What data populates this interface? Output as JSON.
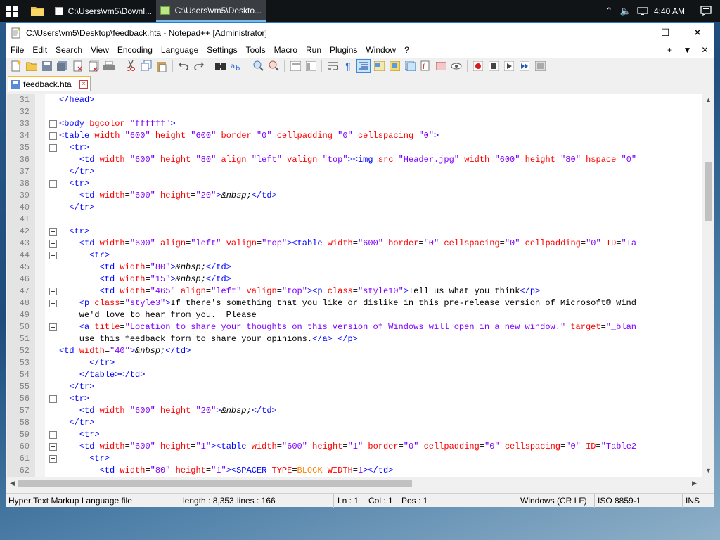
{
  "taskbar": {
    "tasks": [
      {
        "label": "C:\\Users\\vm5\\Downl..."
      },
      {
        "label": "C:\\Users\\vm5\\Deskto..."
      }
    ],
    "clock": "4:40 AM"
  },
  "window": {
    "title": "C:\\Users\\vm5\\Desktop\\feedback.hta - Notepad++ [Administrator]",
    "menus": [
      "File",
      "Edit",
      "Search",
      "View",
      "Encoding",
      "Language",
      "Settings",
      "Tools",
      "Macro",
      "Run",
      "Plugins",
      "Window",
      "?"
    ],
    "menu_right": [
      "+",
      "▼",
      "✕"
    ],
    "tab": {
      "label": "feedback.hta"
    }
  },
  "editor": {
    "lines": [
      {
        "n": "31",
        "fold": "line",
        "segs": [
          [
            "t",
            "</head>"
          ]
        ]
      },
      {
        "n": "32",
        "fold": "line",
        "segs": []
      },
      {
        "n": "33",
        "fold": "box",
        "segs": [
          [
            "t",
            "<body "
          ],
          [
            "a",
            "bgcolor"
          ],
          [
            "x",
            "="
          ],
          [
            "v",
            "\"ffffff\""
          ],
          [
            "t",
            ">"
          ]
        ]
      },
      {
        "n": "34",
        "fold": "box",
        "segs": [
          [
            "t",
            "<table "
          ],
          [
            "a",
            "width"
          ],
          [
            "x",
            "="
          ],
          [
            "v",
            "\"600\""
          ],
          [
            "a",
            " height"
          ],
          [
            "x",
            "="
          ],
          [
            "v",
            "\"600\""
          ],
          [
            "a",
            " border"
          ],
          [
            "x",
            "="
          ],
          [
            "v",
            "\"0\""
          ],
          [
            "a",
            " cellpadding"
          ],
          [
            "x",
            "="
          ],
          [
            "v",
            "\"0\""
          ],
          [
            "a",
            " cellspacing"
          ],
          [
            "x",
            "="
          ],
          [
            "v",
            "\"0\""
          ],
          [
            "t",
            ">"
          ]
        ]
      },
      {
        "n": "35",
        "fold": "box",
        "segs": [
          [
            "x",
            "  "
          ],
          [
            "t",
            "<tr>"
          ]
        ]
      },
      {
        "n": "36",
        "fold": "line",
        "segs": [
          [
            "x",
            "    "
          ],
          [
            "t",
            "<td "
          ],
          [
            "a",
            "width"
          ],
          [
            "x",
            "="
          ],
          [
            "v",
            "\"600\""
          ],
          [
            "a",
            " height"
          ],
          [
            "x",
            "="
          ],
          [
            "v",
            "\"80\""
          ],
          [
            "a",
            " align"
          ],
          [
            "x",
            "="
          ],
          [
            "v",
            "\"left\""
          ],
          [
            "a",
            " valign"
          ],
          [
            "x",
            "="
          ],
          [
            "v",
            "\"top\""
          ],
          [
            "t",
            "><img "
          ],
          [
            "a",
            "src"
          ],
          [
            "x",
            "="
          ],
          [
            "v",
            "\"Header.jpg\""
          ],
          [
            "a",
            " width"
          ],
          [
            "x",
            "="
          ],
          [
            "v",
            "\"600\""
          ],
          [
            "a",
            " height"
          ],
          [
            "x",
            "="
          ],
          [
            "v",
            "\"80\""
          ],
          [
            "a",
            " hspace"
          ],
          [
            "x",
            "="
          ],
          [
            "v",
            "\"0\""
          ]
        ]
      },
      {
        "n": "37",
        "fold": "line",
        "segs": [
          [
            "x",
            "  "
          ],
          [
            "t",
            "</tr>"
          ]
        ]
      },
      {
        "n": "38",
        "fold": "box",
        "segs": [
          [
            "x",
            "  "
          ],
          [
            "t",
            "<tr>"
          ]
        ]
      },
      {
        "n": "39",
        "fold": "line",
        "segs": [
          [
            "x",
            "    "
          ],
          [
            "t",
            "<td "
          ],
          [
            "a",
            "width"
          ],
          [
            "x",
            "="
          ],
          [
            "v",
            "\"600\""
          ],
          [
            "a",
            " height"
          ],
          [
            "x",
            "="
          ],
          [
            "v",
            "\"20\""
          ],
          [
            "t",
            ">"
          ],
          [
            "e",
            "&nbsp;"
          ],
          [
            "t",
            "</td>"
          ]
        ]
      },
      {
        "n": "40",
        "fold": "line",
        "segs": [
          [
            "x",
            "  "
          ],
          [
            "t",
            "</tr>"
          ]
        ]
      },
      {
        "n": "41",
        "fold": "line",
        "segs": []
      },
      {
        "n": "42",
        "fold": "box",
        "segs": [
          [
            "x",
            "  "
          ],
          [
            "t",
            "<tr>"
          ]
        ]
      },
      {
        "n": "43",
        "fold": "box",
        "segs": [
          [
            "x",
            "    "
          ],
          [
            "t",
            "<td "
          ],
          [
            "a",
            "width"
          ],
          [
            "x",
            "="
          ],
          [
            "v",
            "\"600\""
          ],
          [
            "a",
            " align"
          ],
          [
            "x",
            "="
          ],
          [
            "v",
            "\"left\""
          ],
          [
            "a",
            " valign"
          ],
          [
            "x",
            "="
          ],
          [
            "v",
            "\"top\""
          ],
          [
            "t",
            "><table "
          ],
          [
            "a",
            "width"
          ],
          [
            "x",
            "="
          ],
          [
            "v",
            "\"600\""
          ],
          [
            "a",
            " border"
          ],
          [
            "x",
            "="
          ],
          [
            "v",
            "\"0\""
          ],
          [
            "a",
            " cellspacing"
          ],
          [
            "x",
            "="
          ],
          [
            "v",
            "\"0\""
          ],
          [
            "a",
            " cellpadding"
          ],
          [
            "x",
            "="
          ],
          [
            "v",
            "\"0\""
          ],
          [
            "a",
            " ID"
          ],
          [
            "x",
            "="
          ],
          [
            "v",
            "\"Ta"
          ]
        ]
      },
      {
        "n": "44",
        "fold": "box",
        "segs": [
          [
            "x",
            "      "
          ],
          [
            "t",
            "<tr>"
          ]
        ]
      },
      {
        "n": "45",
        "fold": "line",
        "segs": [
          [
            "x",
            "        "
          ],
          [
            "t",
            "<td "
          ],
          [
            "a",
            "width"
          ],
          [
            "x",
            "="
          ],
          [
            "v",
            "\"80\""
          ],
          [
            "t",
            ">"
          ],
          [
            "e",
            "&nbsp;"
          ],
          [
            "t",
            "</td>"
          ]
        ]
      },
      {
        "n": "46",
        "fold": "line",
        "segs": [
          [
            "x",
            "        "
          ],
          [
            "t",
            "<td "
          ],
          [
            "a",
            "width"
          ],
          [
            "x",
            "="
          ],
          [
            "v",
            "\"15\""
          ],
          [
            "t",
            ">"
          ],
          [
            "e",
            "&nbsp;"
          ],
          [
            "t",
            "</td>"
          ]
        ]
      },
      {
        "n": "47",
        "fold": "box",
        "segs": [
          [
            "x",
            "        "
          ],
          [
            "t",
            "<td "
          ],
          [
            "a",
            "width"
          ],
          [
            "x",
            "="
          ],
          [
            "v",
            "\"465\""
          ],
          [
            "a",
            " align"
          ],
          [
            "x",
            "="
          ],
          [
            "v",
            "\"left\""
          ],
          [
            "a",
            " valign"
          ],
          [
            "x",
            "="
          ],
          [
            "v",
            "\"top\""
          ],
          [
            "t",
            "><p "
          ],
          [
            "a",
            "class"
          ],
          [
            "x",
            "="
          ],
          [
            "v",
            "\"style10\""
          ],
          [
            "t",
            ">"
          ],
          [
            "x",
            "Tell us what you think"
          ],
          [
            "t",
            "</p>"
          ]
        ]
      },
      {
        "n": "48",
        "fold": "box",
        "segs": [
          [
            "x",
            "    "
          ],
          [
            "t",
            "<p "
          ],
          [
            "a",
            "class"
          ],
          [
            "x",
            "="
          ],
          [
            "v",
            "\"style3\""
          ],
          [
            "t",
            ">"
          ],
          [
            "x",
            "If there's something that you like or dislike in this pre-release version of Microsoft® Wind"
          ]
        ]
      },
      {
        "n": "49",
        "fold": "line",
        "segs": [
          [
            "x",
            "    we'd love to hear from you.  Please"
          ]
        ]
      },
      {
        "n": "50",
        "fold": "box",
        "segs": [
          [
            "x",
            "    "
          ],
          [
            "t",
            "<a "
          ],
          [
            "a",
            "title"
          ],
          [
            "x",
            "="
          ],
          [
            "v",
            "\"Location to share your thoughts on this version of Windows will open in a new window.\""
          ],
          [
            "a",
            " target"
          ],
          [
            "x",
            "="
          ],
          [
            "v",
            "\"_blan"
          ]
        ]
      },
      {
        "n": "51",
        "fold": "line",
        "segs": [
          [
            "x",
            "    use this feedback form to share your opinions."
          ],
          [
            "t",
            "</a> </p>"
          ]
        ]
      },
      {
        "n": "52",
        "fold": "line",
        "segs": [
          [
            "t",
            "<td "
          ],
          [
            "a",
            "width"
          ],
          [
            "x",
            "="
          ],
          [
            "v",
            "\"40\""
          ],
          [
            "t",
            ">"
          ],
          [
            "e",
            "&nbsp;"
          ],
          [
            "t",
            "</td>"
          ]
        ]
      },
      {
        "n": "53",
        "fold": "line",
        "segs": [
          [
            "x",
            "      "
          ],
          [
            "t",
            "</tr>"
          ]
        ]
      },
      {
        "n": "54",
        "fold": "line",
        "segs": [
          [
            "x",
            "    "
          ],
          [
            "t",
            "</table></td>"
          ]
        ]
      },
      {
        "n": "55",
        "fold": "line",
        "segs": [
          [
            "x",
            "  "
          ],
          [
            "t",
            "</tr>"
          ]
        ]
      },
      {
        "n": "56",
        "fold": "box",
        "segs": [
          [
            "x",
            "  "
          ],
          [
            "t",
            "<tr>"
          ]
        ]
      },
      {
        "n": "57",
        "fold": "line",
        "segs": [
          [
            "x",
            "    "
          ],
          [
            "t",
            "<td "
          ],
          [
            "a",
            "width"
          ],
          [
            "x",
            "="
          ],
          [
            "v",
            "\"600\""
          ],
          [
            "a",
            " height"
          ],
          [
            "x",
            "="
          ],
          [
            "v",
            "\"20\""
          ],
          [
            "t",
            ">"
          ],
          [
            "e",
            "&nbsp;"
          ],
          [
            "t",
            "</td>"
          ]
        ]
      },
      {
        "n": "58",
        "fold": "line",
        "segs": [
          [
            "x",
            "  "
          ],
          [
            "t",
            "</tr>"
          ]
        ]
      },
      {
        "n": "59",
        "fold": "box",
        "segs": [
          [
            "x",
            "    "
          ],
          [
            "t",
            "<tr>"
          ]
        ]
      },
      {
        "n": "60",
        "fold": "box",
        "segs": [
          [
            "x",
            "    "
          ],
          [
            "t",
            "<td "
          ],
          [
            "a",
            "width"
          ],
          [
            "x",
            "="
          ],
          [
            "v",
            "\"600\""
          ],
          [
            "a",
            " height"
          ],
          [
            "x",
            "="
          ],
          [
            "v",
            "\"1\""
          ],
          [
            "t",
            "><table "
          ],
          [
            "a",
            "width"
          ],
          [
            "x",
            "="
          ],
          [
            "v",
            "\"600\""
          ],
          [
            "a",
            " height"
          ],
          [
            "x",
            "="
          ],
          [
            "v",
            "\"1\""
          ],
          [
            "a",
            " border"
          ],
          [
            "x",
            "="
          ],
          [
            "v",
            "\"0\""
          ],
          [
            "a",
            " cellpadding"
          ],
          [
            "x",
            "="
          ],
          [
            "v",
            "\"0\""
          ],
          [
            "a",
            " cellspacing"
          ],
          [
            "x",
            "="
          ],
          [
            "v",
            "\"0\""
          ],
          [
            "a",
            " ID"
          ],
          [
            "x",
            "="
          ],
          [
            "v",
            "\"Table2"
          ]
        ]
      },
      {
        "n": "61",
        "fold": "box",
        "segs": [
          [
            "x",
            "      "
          ],
          [
            "t",
            "<tr>"
          ]
        ]
      },
      {
        "n": "62",
        "fold": "line",
        "segs": [
          [
            "x",
            "        "
          ],
          [
            "t",
            "<td "
          ],
          [
            "a",
            "width"
          ],
          [
            "x",
            "="
          ],
          [
            "v",
            "\"80\""
          ],
          [
            "a",
            " height"
          ],
          [
            "x",
            "="
          ],
          [
            "v",
            "\"1\""
          ],
          [
            "t",
            "><SPACER "
          ],
          [
            "a",
            "TYPE"
          ],
          [
            "x",
            "="
          ],
          [
            "k",
            "BLOCK"
          ],
          [
            "a",
            " WIDTH"
          ],
          [
            "x",
            "="
          ],
          [
            "v",
            "1"
          ],
          [
            "t",
            "></td>"
          ]
        ]
      }
    ]
  },
  "status": {
    "filetype": "Hyper Text Markup Language file",
    "length": "length : 8,353",
    "lines": "lines : 166",
    "ln": "Ln : 1",
    "col": "Col : 1",
    "pos": "Pos : 1",
    "eol": "Windows (CR LF)",
    "encoding": "ISO 8859-1",
    "mode": "INS"
  },
  "colors": {
    "tag": "#0000ff",
    "attribute": "#ff0000",
    "value": "#8000ff",
    "entity": "#000000",
    "keyword": "#ff8000"
  }
}
